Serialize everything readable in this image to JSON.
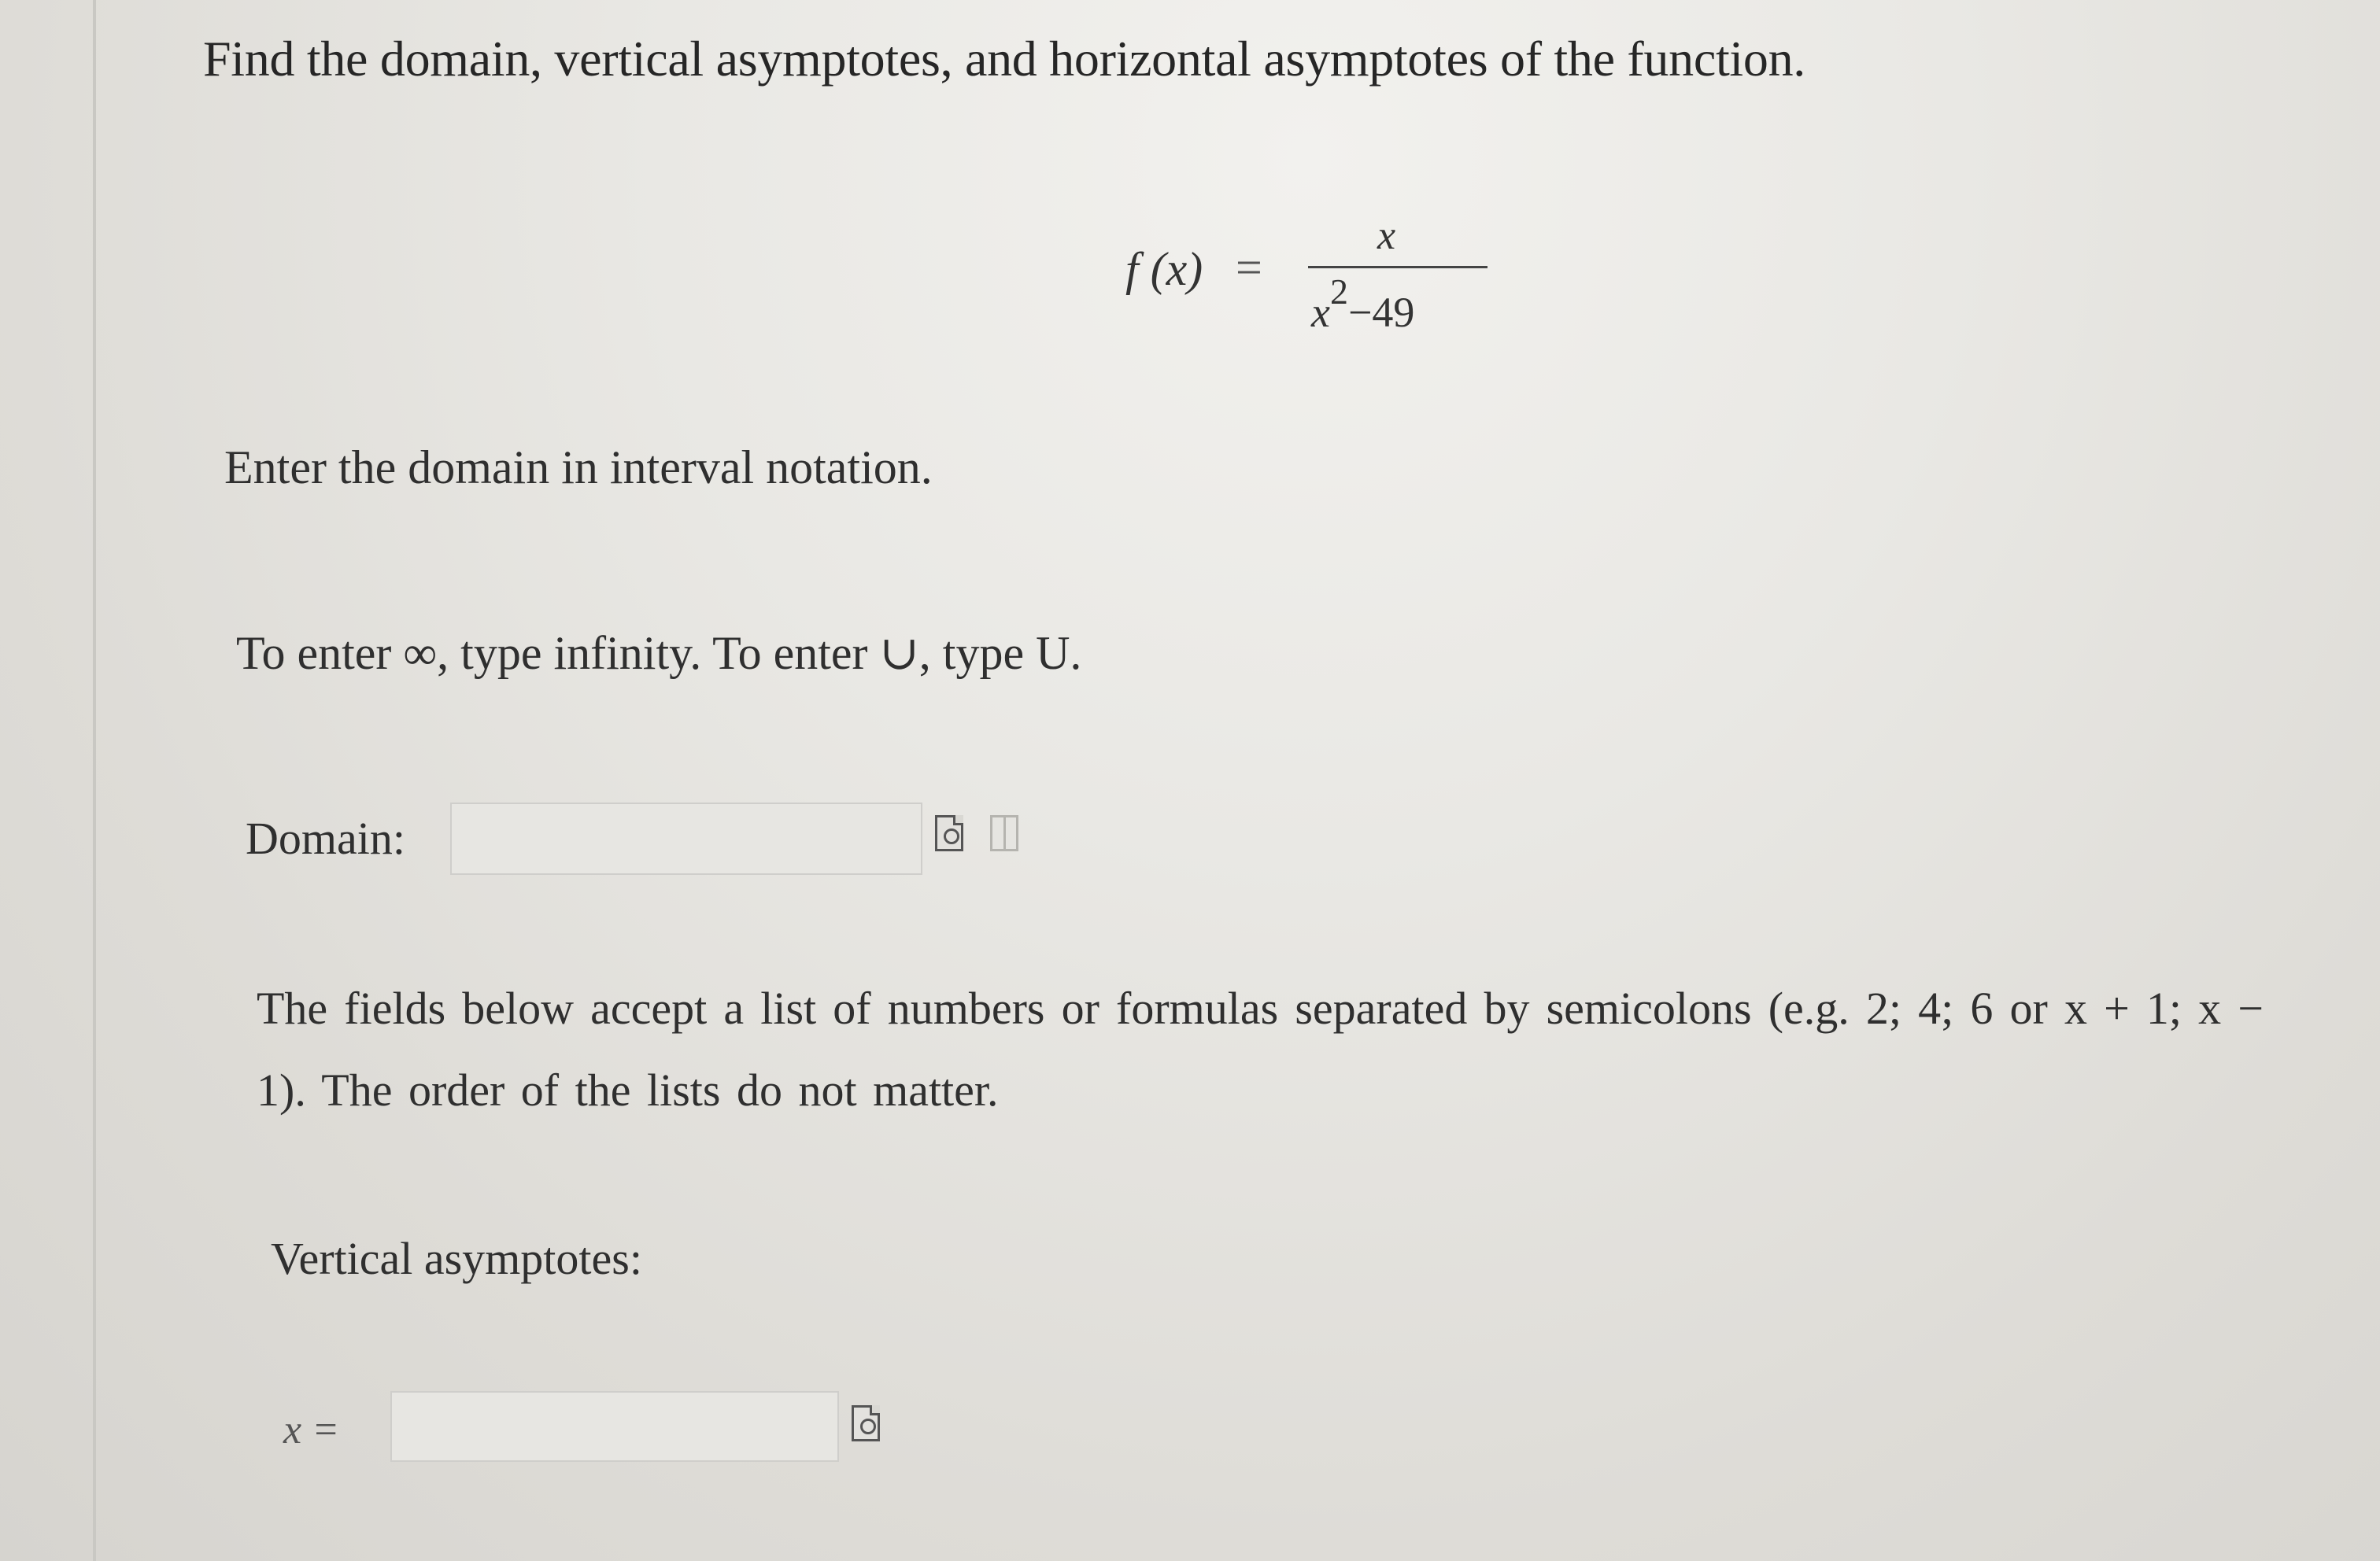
{
  "question": {
    "title": "Find the domain, vertical asymptotes, and horizontal asymptotes of the function.",
    "formula": {
      "lhs": "f (x)",
      "equals": "=",
      "numerator": "x",
      "denominator_base": "x",
      "denominator_exponent": "2",
      "denominator_rest": "−49"
    },
    "domain_instruction": "Enter the domain in interval notation.",
    "hint": "To enter ∞, type infinity. To enter ∪, type U."
  },
  "domain": {
    "label": "Domain:",
    "value": ""
  },
  "list_note": "The fields below accept a list of numbers or formulas separated by semicolons (e.g. 2; 4; 6 or x + 1; x − 1). The order of the lists do not matter.",
  "vertical_asymptotes": {
    "label": "Vertical asymptotes:",
    "variable_label": "x =",
    "value": ""
  },
  "icons": {
    "preview": "preview-icon",
    "help": "help-icon"
  }
}
